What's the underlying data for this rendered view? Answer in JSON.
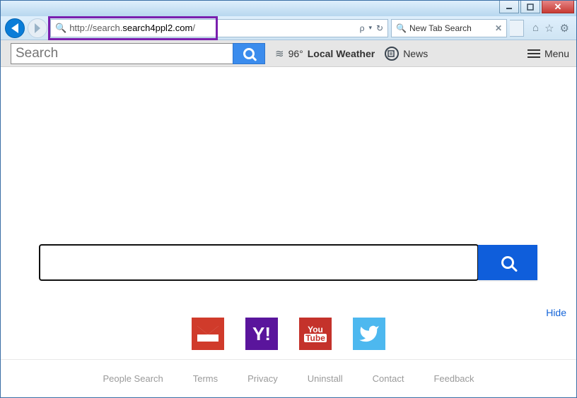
{
  "window_controls": {
    "min": "__",
    "max": "▢",
    "close": "✕"
  },
  "browser": {
    "url_prefix": "http://search.",
    "url_bold": "search4ppl2.com",
    "url_suffix": "/",
    "search_glyph": "🔍",
    "dropdown_glyph": "▾",
    "refresh_glyph": "↻",
    "search_icon_glyph": "ρ"
  },
  "tab": {
    "title": "New Tab Search",
    "close": "✕"
  },
  "chrome_icons": {
    "home": "⌂",
    "star": "☆",
    "gear": "⚙"
  },
  "pagebar": {
    "search_placeholder": "Search",
    "weather_temp": "96°",
    "weather_label": "Local Weather",
    "weather_glyph": "≋",
    "news_label": "News",
    "news_glyph": "📰",
    "menu_label": "Menu"
  },
  "main_search": {
    "placeholder": ""
  },
  "hide_label": "Hide",
  "brands": {
    "gmail": "M",
    "yahoo": "Y!",
    "youtube_top": "You",
    "youtube_bot": "Tube"
  },
  "footer": {
    "people": "People Search",
    "terms": "Terms",
    "privacy": "Privacy",
    "uninstall": "Uninstall",
    "contact": "Contact",
    "feedback": "Feedback"
  }
}
